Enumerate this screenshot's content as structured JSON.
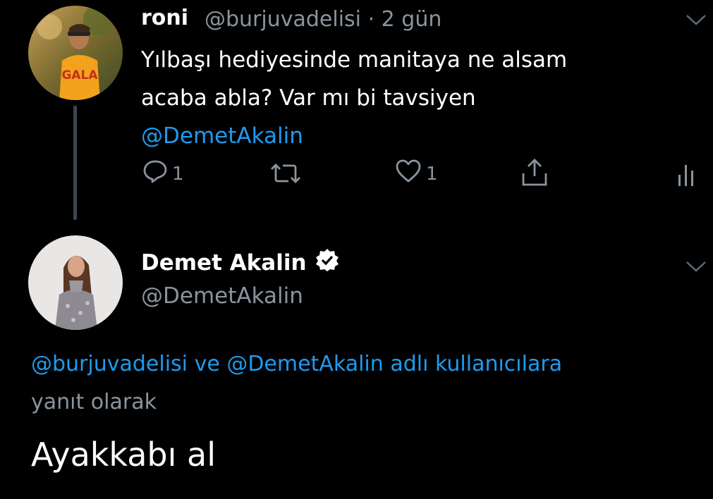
{
  "tweet1": {
    "display_name": "roni",
    "handle": "@burjuvadelisi",
    "separator": "·",
    "time": "2 gün",
    "text_line1": "Yılbaşı hediyesinde manitaya ne alsam",
    "text_line2": "acaba abla? Var mı bi tavsiyen",
    "mention": "@DemetAkalin",
    "reply_count": "1",
    "like_count": "1",
    "avatar_shirt_text": "GALA"
  },
  "tweet2": {
    "display_name": "Demet Akalin",
    "handle": "@DemetAkalin",
    "reply_mention_1": "@burjuvadelisi",
    "reply_joiner": "ve",
    "reply_mention_2": "@DemetAkalin",
    "reply_suffix": "adlı kullanıcılara",
    "reply_line2": "yanıt olarak",
    "text": "Ayakkabı al"
  },
  "icons": {
    "reply": "reply-icon",
    "retweet": "retweet-icon",
    "like": "heart-icon",
    "share": "share-icon",
    "analytics": "analytics-icon",
    "more": "chevron-down-icon",
    "verified": "verified-badge-icon"
  },
  "colors": {
    "background": "#000000",
    "accent": "#1d9bf0",
    "muted": "#8a949e"
  }
}
